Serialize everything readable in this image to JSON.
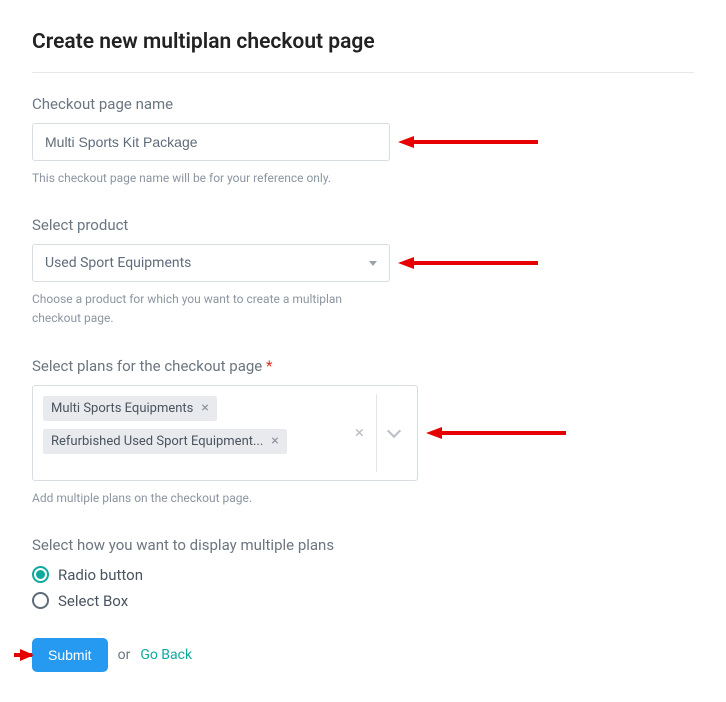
{
  "page_title": "Create new multiplan checkout page",
  "fields": {
    "checkout_name": {
      "label": "Checkout page name",
      "value": "Multi Sports Kit Package",
      "helper": "This checkout page name will be for your reference only."
    },
    "select_product": {
      "label": "Select product",
      "value": "Used Sport Equipments",
      "helper": "Choose a product for which you want to create a multiplan checkout page."
    },
    "select_plans": {
      "label": "Select plans for the checkout page",
      "required_mark": "*",
      "tags": [
        "Multi Sports Equipments",
        "Refurbished Used Sport Equipment..."
      ],
      "helper": "Add multiple plans on the checkout page."
    },
    "display_mode": {
      "label": "Select how you want to display multiple plans",
      "options": [
        "Radio button",
        "Select Box"
      ],
      "selected": "Radio button"
    }
  },
  "actions": {
    "submit": "Submit",
    "or": "or",
    "go_back": "Go Back"
  }
}
